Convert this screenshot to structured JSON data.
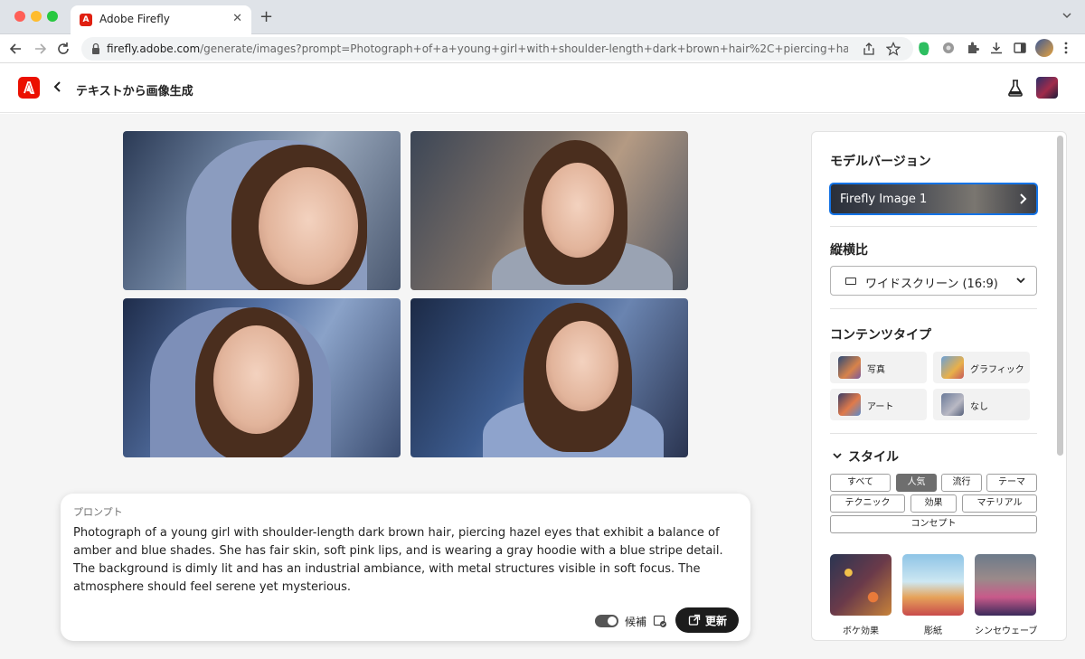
{
  "browser": {
    "tab_title": "Adobe Firefly",
    "url_host": "firefly.adobe.com",
    "url_path": "/generate/images?prompt=Photograph+of+a+young+girl+with+shoulder-length+dark+brown+hair%2C+piercing+hazel+eyes+that+..."
  },
  "header": {
    "title": "テキストから画像生成"
  },
  "prompt": {
    "label": "プロンプト",
    "text": "Photograph of a young girl with shoulder-length dark brown hair, piercing hazel eyes that exhibit a balance of amber and blue shades. She has fair skin, soft pink lips, and is wearing a gray hoodie with a blue stripe detail. The background is dimly lit and has an industrial ambiance, with metal structures visible in soft focus. The atmosphere should feel serene yet mysterious.",
    "toggle_label": "候補",
    "update_label": "更新"
  },
  "panel": {
    "model_title": "モデルバージョン",
    "model_value": "Firefly Image 1",
    "aspect_title": "縦横比",
    "aspect_value": "ワイドスクリーン (16:9)",
    "content_title": "コンテンツタイプ",
    "content_types": [
      "写真",
      "グラフィック",
      "アート",
      "なし"
    ],
    "style_title": "スタイル",
    "style_chips": [
      "すべて",
      "人気",
      "流行",
      "テーマ",
      "テクニック",
      "効果",
      "マテリアル",
      "コンセプト"
    ],
    "style_cards": [
      "ボケ効果",
      "彫紙",
      "シンセウェーブ"
    ]
  },
  "colors": {
    "accent": "#1473e6",
    "brand": "#eb1000",
    "button_dark": "#1c1c1c"
  }
}
